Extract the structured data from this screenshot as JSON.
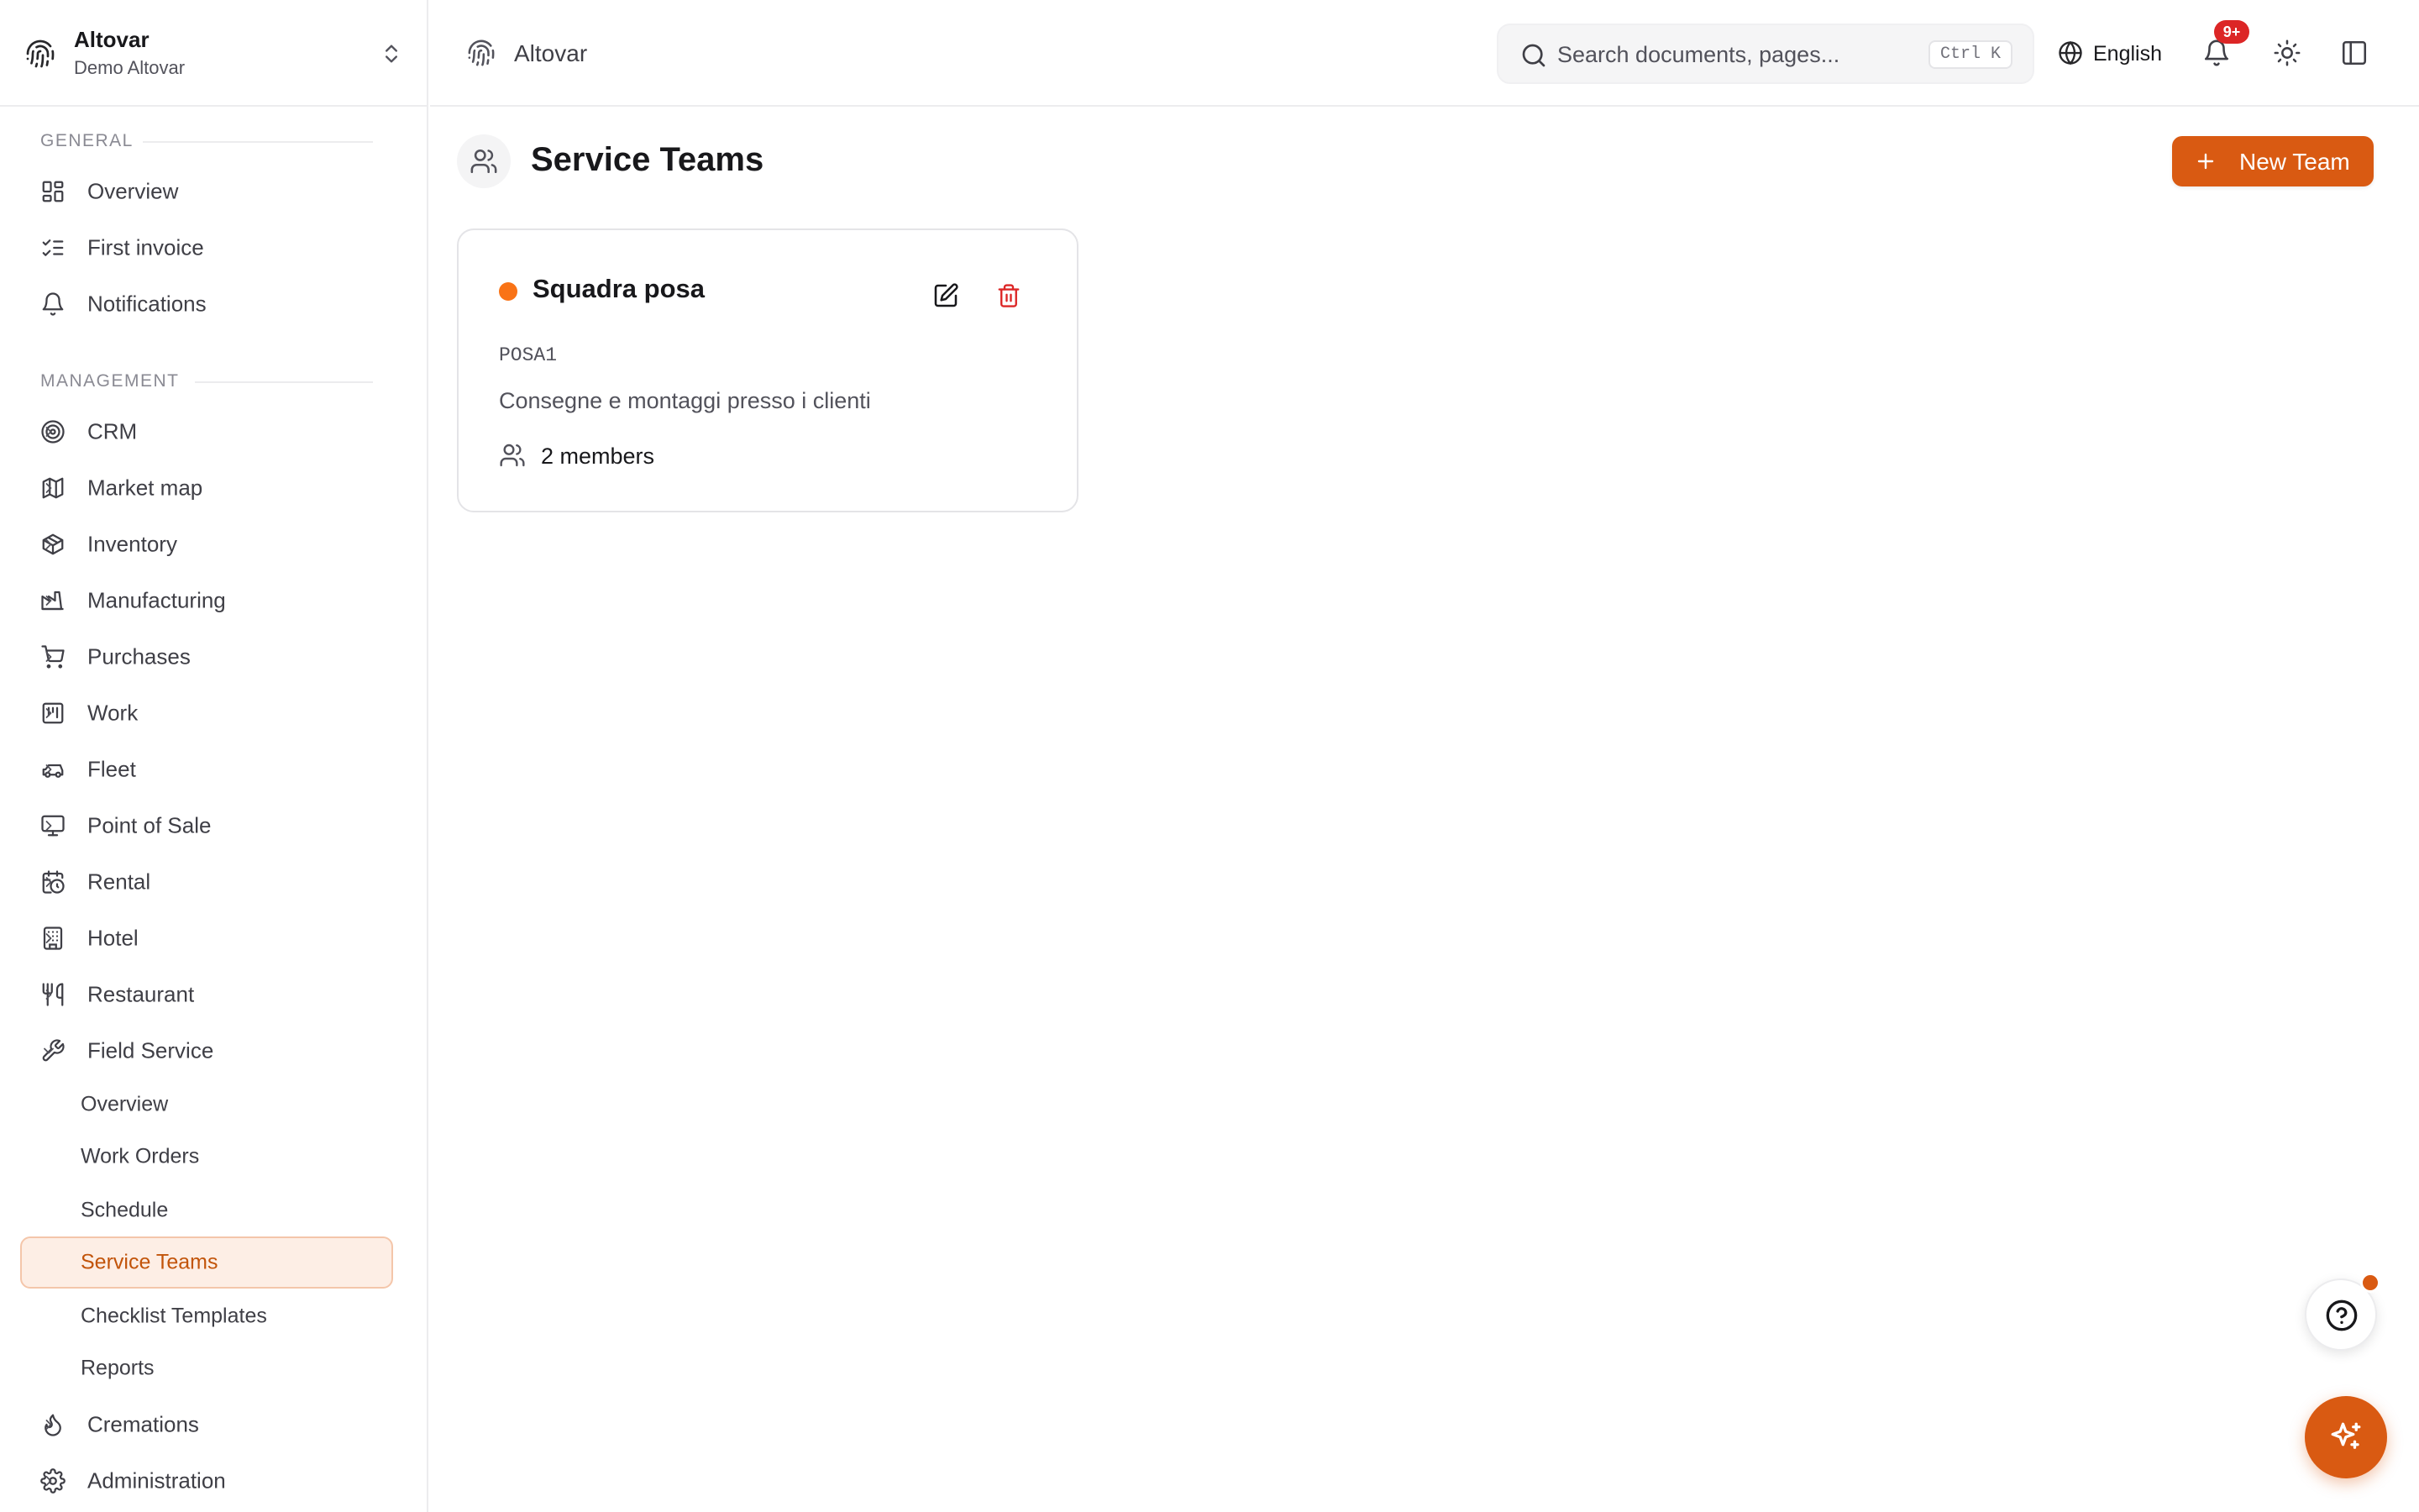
{
  "org": {
    "name": "Altovar",
    "subtitle": "Demo Altovar"
  },
  "sidebar": {
    "general_label": "GENERAL",
    "general_items": [
      {
        "label": "Overview",
        "icon": "layout-dashboard-icon"
      },
      {
        "label": "First invoice",
        "icon": "list-checks-icon"
      },
      {
        "label": "Notifications",
        "icon": "bell-icon"
      }
    ],
    "management_label": "MANAGEMENT",
    "management_items": [
      {
        "label": "CRM",
        "icon": "target-icon"
      },
      {
        "label": "Market map",
        "icon": "map-icon"
      },
      {
        "label": "Inventory",
        "icon": "package-icon"
      },
      {
        "label": "Manufacturing",
        "icon": "factory-icon"
      },
      {
        "label": "Purchases",
        "icon": "shopping-cart-icon"
      },
      {
        "label": "Work",
        "icon": "kanban-icon"
      },
      {
        "label": "Fleet",
        "icon": "car-icon"
      },
      {
        "label": "Point of Sale",
        "icon": "monitor-icon"
      },
      {
        "label": "Rental",
        "icon": "calendar-clock-icon"
      },
      {
        "label": "Hotel",
        "icon": "building-icon"
      },
      {
        "label": "Restaurant",
        "icon": "utensils-icon"
      },
      {
        "label": "Field Service",
        "icon": "wrench-icon"
      }
    ],
    "field_service_sub": [
      {
        "label": "Overview"
      },
      {
        "label": "Work Orders"
      },
      {
        "label": "Schedule"
      },
      {
        "label": "Service Teams",
        "active": true
      },
      {
        "label": "Checklist Templates"
      },
      {
        "label": "Reports"
      }
    ],
    "bottom_items": [
      {
        "label": "Cremations",
        "icon": "flame-icon"
      },
      {
        "label": "Administration",
        "icon": "settings-icon"
      }
    ]
  },
  "topbar": {
    "breadcrumb": "Altovar",
    "search_placeholder": "Search documents, pages...",
    "search_shortcut": "Ctrl K",
    "language": "English",
    "notification_badge": "9+"
  },
  "main": {
    "title": "Service Teams",
    "new_button": "New Team",
    "teams": [
      {
        "name": "Squadra posa",
        "code": "POSA1",
        "description": "Consegne e montaggi presso i clienti",
        "members": "2 members",
        "color": "#f97316"
      }
    ]
  },
  "colors": {
    "accent": "#d95a12",
    "active_bg": "#fdeee5",
    "danger": "#dc2626"
  }
}
